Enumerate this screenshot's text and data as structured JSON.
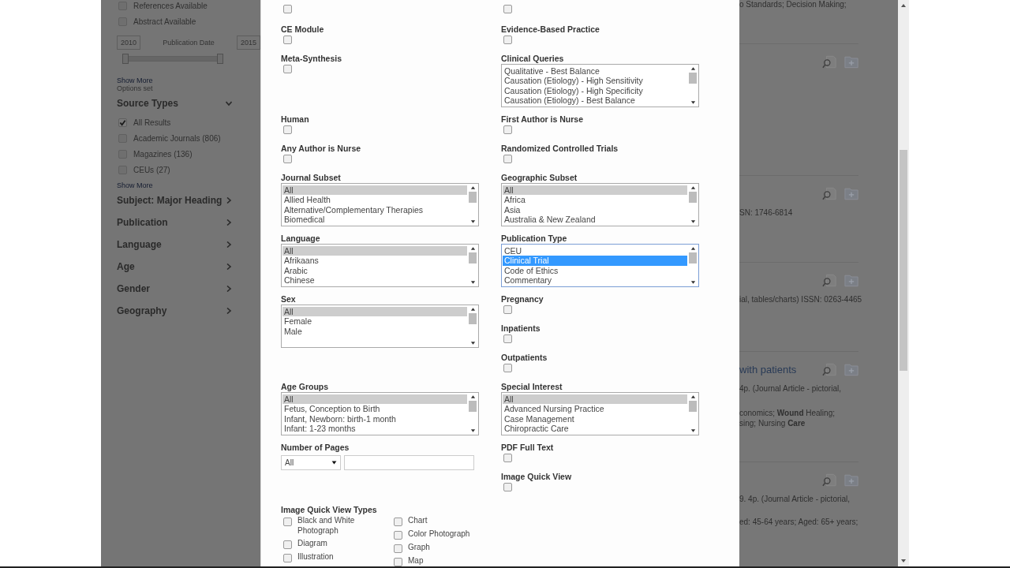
{
  "sidebar": {
    "filters": [
      {
        "label": "References Available",
        "checked": false
      },
      {
        "label": "Abstract Available",
        "checked": false
      }
    ],
    "date_range": {
      "from": "2010",
      "label": "Publication Date",
      "to": "2015",
      "level": 1
    },
    "show_more": "Show More",
    "options_note": "Options set",
    "facets": [
      {
        "title": "Source Types",
        "expanded": true,
        "options": [
          {
            "label": "All Results",
            "checked": true
          },
          {
            "label": "Academic Journals (806)",
            "checked": false
          },
          {
            "label": "Magazines (136)",
            "checked": false
          },
          {
            "label": "CEUs (27)",
            "checked": false
          }
        ],
        "show_more": "Show More"
      },
      {
        "title": "Subject: Major Heading",
        "expanded": false
      },
      {
        "title": "Publication",
        "expanded": false
      },
      {
        "title": "Language",
        "expanded": false
      },
      {
        "title": "Age",
        "expanded": false
      },
      {
        "title": "Gender",
        "expanded": false
      },
      {
        "title": "Geography",
        "expanded": false
      }
    ]
  },
  "modal": {
    "rows": [
      {
        "left": [
          {
            "kind": "checkbox",
            "checked": false
          }
        ],
        "right": [
          {
            "kind": "checkbox",
            "checked": false
          }
        ]
      },
      {
        "left": [
          {
            "kind": "checkbox",
            "label": "CE Module",
            "checked": false
          }
        ],
        "right": [
          {
            "kind": "checkbox",
            "label": "Evidence-Based Practice",
            "checked": false
          }
        ]
      },
      {
        "left": [
          {
            "kind": "checkbox",
            "label": "Meta-Synthesis",
            "checked": false
          }
        ],
        "right": [
          {
            "kind": "listbox",
            "label": "Clinical Queries",
            "focused": false,
            "options": [
              {
                "label": "Qualitative - Best Balance",
                "selected": false
              },
              {
                "label": "Causation (Etiology) - High Sensitivity",
                "selected": false
              },
              {
                "label": "Causation (Etiology) - High Specificity",
                "selected": false
              },
              {
                "label": "Causation (Etiology) - Best Balance",
                "selected": false
              }
            ]
          }
        ]
      },
      {
        "left": [
          {
            "kind": "checkbox",
            "label": "Human",
            "checked": false
          }
        ],
        "right": [
          {
            "kind": "checkbox",
            "label": "First Author is Nurse",
            "checked": false
          }
        ]
      },
      {
        "left": [
          {
            "kind": "checkbox",
            "label": "Any Author is Nurse",
            "checked": false
          }
        ],
        "right": [
          {
            "kind": "checkbox",
            "label": "Randomized Controlled Trials",
            "checked": false
          }
        ]
      },
      {
        "left": [
          {
            "kind": "listbox",
            "label": "Journal Subset",
            "focused": false,
            "options": [
              {
                "label": "All",
                "selected": true
              },
              {
                "label": "Allied Health",
                "selected": false
              },
              {
                "label": "Alternative/Complementary Therapies",
                "selected": false
              },
              {
                "label": "Biomedical",
                "selected": false
              }
            ]
          }
        ],
        "right": [
          {
            "kind": "listbox",
            "label": "Geographic Subset",
            "focused": false,
            "options": [
              {
                "label": "All",
                "selected": true
              },
              {
                "label": "Africa",
                "selected": false
              },
              {
                "label": "Asia",
                "selected": false
              },
              {
                "label": "Australia & New Zealand",
                "selected": false
              }
            ]
          }
        ]
      },
      {
        "left": [
          {
            "kind": "listbox",
            "label": "Language",
            "focused": false,
            "options": [
              {
                "label": "All",
                "selected": true
              },
              {
                "label": "Afrikaans",
                "selected": false
              },
              {
                "label": "Arabic",
                "selected": false
              },
              {
                "label": "Chinese",
                "selected": false
              }
            ]
          }
        ],
        "right": [
          {
            "kind": "listbox",
            "label": "Publication Type",
            "focused": true,
            "options": [
              {
                "label": "CEU",
                "selected": false
              },
              {
                "label": "Clinical Trial",
                "selected": true
              },
              {
                "label": "Code of Ethics",
                "selected": false
              },
              {
                "label": "Commentary",
                "selected": false
              }
            ]
          }
        ]
      },
      {
        "left": [
          {
            "kind": "listbox",
            "label": "Sex",
            "focused": false,
            "options": [
              {
                "label": "All",
                "selected": true
              },
              {
                "label": "Female",
                "selected": false
              },
              {
                "label": "Male",
                "selected": false
              }
            ]
          }
        ],
        "right": [
          {
            "kind": "checkbox",
            "label": "Pregnancy",
            "checked": false
          },
          {
            "kind": "checkbox",
            "label": "Inpatients",
            "checked": false
          },
          {
            "kind": "checkbox",
            "label": "Outpatients",
            "checked": false
          }
        ]
      },
      {
        "left": [
          {
            "kind": "listbox",
            "label": "Age Groups",
            "focused": false,
            "options": [
              {
                "label": "All",
                "selected": true
              },
              {
                "label": "Fetus, Conception to Birth",
                "selected": false
              },
              {
                "label": "Infant, Newborn: birth-1 month",
                "selected": false
              },
              {
                "label": "Infant: 1-23 months",
                "selected": false
              }
            ]
          }
        ],
        "right": [
          {
            "kind": "listbox",
            "label": "Special Interest",
            "focused": false,
            "options": [
              {
                "label": "All",
                "selected": true
              },
              {
                "label": "Advanced Nursing Practice",
                "selected": false
              },
              {
                "label": "Case Management",
                "selected": false
              },
              {
                "label": "Chiropractic Care",
                "selected": false
              }
            ]
          }
        ]
      },
      {
        "left": [
          {
            "kind": "pages",
            "label": "Number of Pages",
            "select": "All"
          }
        ],
        "right": [
          {
            "kind": "checkbox",
            "label": "PDF Full Text",
            "checked": false
          },
          {
            "kind": "checkbox",
            "label": "Image Quick View",
            "checked": false
          }
        ]
      },
      {
        "left": [
          {
            "kind": "imagetypes",
            "label": "Image Quick View Types",
            "columns": [
              [
                {
                  "label": "Black and White Photograph",
                  "checked": false
                },
                {
                  "label": "Diagram",
                  "checked": false
                },
                {
                  "label": "Illustration",
                  "checked": false
                }
              ],
              [
                {
                  "label": "Chart",
                  "checked": false
                },
                {
                  "label": "Color Photograph",
                  "checked": false
                },
                {
                  "label": "Graph",
                  "checked": false
                },
                {
                  "label": "Map",
                  "checked": false
                }
              ]
            ]
          }
        ],
        "right": []
      }
    ]
  },
  "results": [
    {
      "kind": "result",
      "lines": [
        "o Standards; Decision Making;"
      ]
    },
    {
      "kind": "result"
    },
    {
      "kind": "result",
      "lines": [
        "SN: 1746-6814"
      ]
    },
    {
      "kind": "result",
      "lines": [
        "ial, tables/charts) ISSN: 0263-4465"
      ]
    },
    {
      "kind": "result",
      "title": "with patients",
      "lines": [
        "4p. (Journal Article - pictorial,",
        "conomics; **Wound** Healing;",
        "sing; Nursing **Care**"
      ]
    },
    {
      "kind": "result",
      "lines": [
        "9. 4p. (Journal Article - pictorial,",
        "ed: 45-64 years; Aged: 65+ years;"
      ]
    }
  ]
}
